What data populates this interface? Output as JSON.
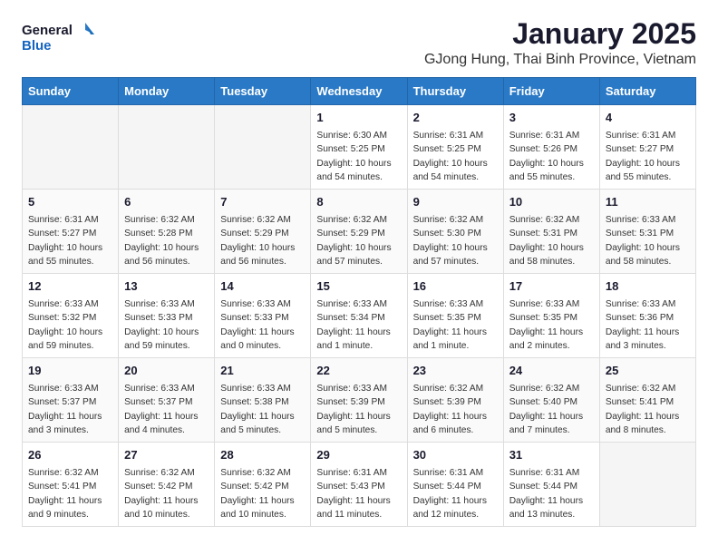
{
  "header": {
    "logo_line1": "General",
    "logo_line2": "Blue",
    "month": "January 2025",
    "location": "GJong Hung, Thai Binh Province, Vietnam"
  },
  "days_of_week": [
    "Sunday",
    "Monday",
    "Tuesday",
    "Wednesday",
    "Thursday",
    "Friday",
    "Saturday"
  ],
  "weeks": [
    [
      {
        "day": "",
        "empty": true
      },
      {
        "day": "",
        "empty": true
      },
      {
        "day": "",
        "empty": true
      },
      {
        "day": "1",
        "sunrise": "6:30 AM",
        "sunset": "5:25 PM",
        "daylight": "10 hours and 54 minutes."
      },
      {
        "day": "2",
        "sunrise": "6:31 AM",
        "sunset": "5:25 PM",
        "daylight": "10 hours and 54 minutes."
      },
      {
        "day": "3",
        "sunrise": "6:31 AM",
        "sunset": "5:26 PM",
        "daylight": "10 hours and 55 minutes."
      },
      {
        "day": "4",
        "sunrise": "6:31 AM",
        "sunset": "5:27 PM",
        "daylight": "10 hours and 55 minutes."
      }
    ],
    [
      {
        "day": "5",
        "sunrise": "6:31 AM",
        "sunset": "5:27 PM",
        "daylight": "10 hours and 55 minutes."
      },
      {
        "day": "6",
        "sunrise": "6:32 AM",
        "sunset": "5:28 PM",
        "daylight": "10 hours and 56 minutes."
      },
      {
        "day": "7",
        "sunrise": "6:32 AM",
        "sunset": "5:29 PM",
        "daylight": "10 hours and 56 minutes."
      },
      {
        "day": "8",
        "sunrise": "6:32 AM",
        "sunset": "5:29 PM",
        "daylight": "10 hours and 57 minutes."
      },
      {
        "day": "9",
        "sunrise": "6:32 AM",
        "sunset": "5:30 PM",
        "daylight": "10 hours and 57 minutes."
      },
      {
        "day": "10",
        "sunrise": "6:32 AM",
        "sunset": "5:31 PM",
        "daylight": "10 hours and 58 minutes."
      },
      {
        "day": "11",
        "sunrise": "6:33 AM",
        "sunset": "5:31 PM",
        "daylight": "10 hours and 58 minutes."
      }
    ],
    [
      {
        "day": "12",
        "sunrise": "6:33 AM",
        "sunset": "5:32 PM",
        "daylight": "10 hours and 59 minutes."
      },
      {
        "day": "13",
        "sunrise": "6:33 AM",
        "sunset": "5:33 PM",
        "daylight": "10 hours and 59 minutes."
      },
      {
        "day": "14",
        "sunrise": "6:33 AM",
        "sunset": "5:33 PM",
        "daylight": "11 hours and 0 minutes."
      },
      {
        "day": "15",
        "sunrise": "6:33 AM",
        "sunset": "5:34 PM",
        "daylight": "11 hours and 1 minute."
      },
      {
        "day": "16",
        "sunrise": "6:33 AM",
        "sunset": "5:35 PM",
        "daylight": "11 hours and 1 minute."
      },
      {
        "day": "17",
        "sunrise": "6:33 AM",
        "sunset": "5:35 PM",
        "daylight": "11 hours and 2 minutes."
      },
      {
        "day": "18",
        "sunrise": "6:33 AM",
        "sunset": "5:36 PM",
        "daylight": "11 hours and 3 minutes."
      }
    ],
    [
      {
        "day": "19",
        "sunrise": "6:33 AM",
        "sunset": "5:37 PM",
        "daylight": "11 hours and 3 minutes."
      },
      {
        "day": "20",
        "sunrise": "6:33 AM",
        "sunset": "5:37 PM",
        "daylight": "11 hours and 4 minutes."
      },
      {
        "day": "21",
        "sunrise": "6:33 AM",
        "sunset": "5:38 PM",
        "daylight": "11 hours and 5 minutes."
      },
      {
        "day": "22",
        "sunrise": "6:33 AM",
        "sunset": "5:39 PM",
        "daylight": "11 hours and 5 minutes."
      },
      {
        "day": "23",
        "sunrise": "6:32 AM",
        "sunset": "5:39 PM",
        "daylight": "11 hours and 6 minutes."
      },
      {
        "day": "24",
        "sunrise": "6:32 AM",
        "sunset": "5:40 PM",
        "daylight": "11 hours and 7 minutes."
      },
      {
        "day": "25",
        "sunrise": "6:32 AM",
        "sunset": "5:41 PM",
        "daylight": "11 hours and 8 minutes."
      }
    ],
    [
      {
        "day": "26",
        "sunrise": "6:32 AM",
        "sunset": "5:41 PM",
        "daylight": "11 hours and 9 minutes."
      },
      {
        "day": "27",
        "sunrise": "6:32 AM",
        "sunset": "5:42 PM",
        "daylight": "11 hours and 10 minutes."
      },
      {
        "day": "28",
        "sunrise": "6:32 AM",
        "sunset": "5:42 PM",
        "daylight": "11 hours and 10 minutes."
      },
      {
        "day": "29",
        "sunrise": "6:31 AM",
        "sunset": "5:43 PM",
        "daylight": "11 hours and 11 minutes."
      },
      {
        "day": "30",
        "sunrise": "6:31 AM",
        "sunset": "5:44 PM",
        "daylight": "11 hours and 12 minutes."
      },
      {
        "day": "31",
        "sunrise": "6:31 AM",
        "sunset": "5:44 PM",
        "daylight": "11 hours and 13 minutes."
      },
      {
        "day": "",
        "empty": true
      }
    ]
  ]
}
